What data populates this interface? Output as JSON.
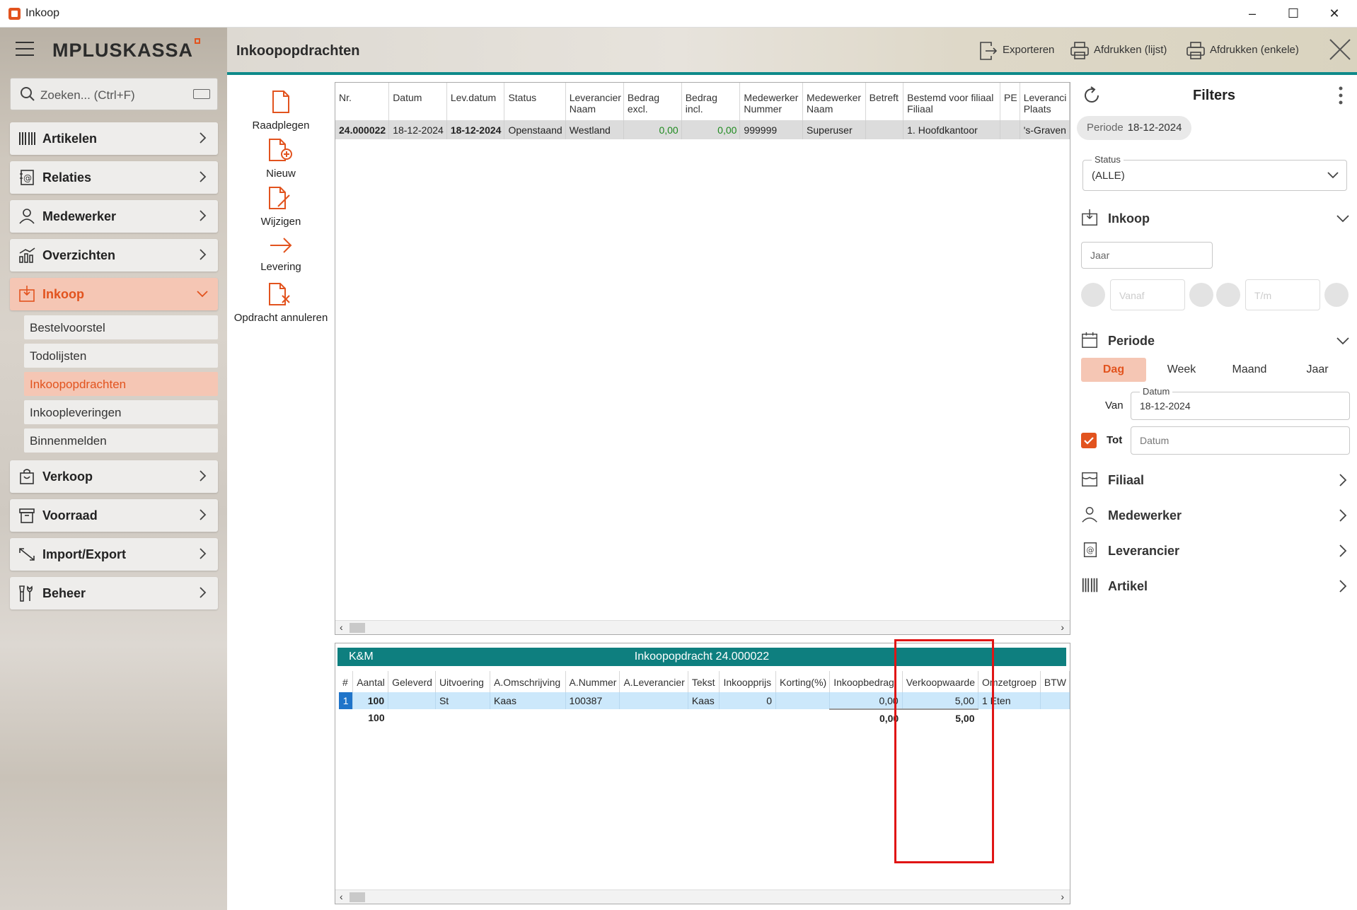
{
  "window": {
    "title": "Inkoop",
    "minimize": "–",
    "maximize": "☐",
    "close": "✕"
  },
  "sidebar": {
    "logo": "MPLUSKASSA",
    "search_placeholder": "Zoeken... (Ctrl+F)",
    "items": [
      {
        "label": "Artikelen",
        "icon": "barcode-icon"
      },
      {
        "label": "Relaties",
        "icon": "contacts-icon"
      },
      {
        "label": "Medewerker",
        "icon": "person-icon"
      },
      {
        "label": "Overzichten",
        "icon": "chart-icon"
      },
      {
        "label": "Inkoop",
        "icon": "inbox-icon"
      },
      {
        "label": "Verkoop",
        "icon": "bag-icon"
      },
      {
        "label": "Voorraad",
        "icon": "archive-icon"
      },
      {
        "label": "Import/Export",
        "icon": "import-export-icon"
      },
      {
        "label": "Beheer",
        "icon": "tools-icon"
      }
    ],
    "subitems": [
      "Bestelvoorstel",
      "Todolijsten",
      "Inkoopopdrachten",
      "Inkoopleveringen",
      "Binnenmelden"
    ],
    "active_item": "Inkoop",
    "active_subitem": "Inkoopopdrachten"
  },
  "header": {
    "title": "Inkoopopdrachten",
    "export": "Exporteren",
    "print_list": "Afdrukken (lijst)",
    "print_single": "Afdrukken (enkele)"
  },
  "actions": [
    "Raadplegen",
    "Nieuw",
    "Wijzigen",
    "Levering",
    "Opdracht annuleren"
  ],
  "top_grid": {
    "columns": [
      [
        "Nr.",
        ""
      ],
      [
        "Datum",
        ""
      ],
      [
        "Lev.datum",
        ""
      ],
      [
        "Status",
        ""
      ],
      [
        "Leverancier",
        "Naam"
      ],
      [
        "Bedrag excl.",
        ""
      ],
      [
        "Bedrag incl.",
        ""
      ],
      [
        "Medewerker",
        "Nummer"
      ],
      [
        "Medewerker",
        "Naam"
      ],
      [
        "Betreft",
        ""
      ],
      [
        "Bestemd voor filiaal",
        "Filiaal"
      ],
      [
        "PE",
        ""
      ],
      [
        "Leveranci",
        "Plaats"
      ]
    ],
    "row": [
      "24.000022",
      "18-12-2024",
      "18-12-2024",
      "Openstaand",
      "Westland",
      "0,00",
      "0,00",
      "999999",
      "Superuser",
      "",
      "1. Hoofdkantoor",
      "",
      "'s-Graven"
    ]
  },
  "bottom_grid": {
    "supplier": "K&M",
    "title": "Inkoopopdracht 24.000022",
    "columns": [
      "#",
      "Aantal",
      "Geleverd",
      "Uitvoering",
      "A.Omschrijving",
      "A.Nummer",
      "A.Leverancier",
      "Tekst",
      "Inkoopprijs",
      "Korting(%)",
      "Inkoopbedrag",
      "Verkoopwaarde",
      "Omzetgroep",
      "BTW"
    ],
    "row": [
      "1",
      "100",
      "",
      "St",
      "Kaas",
      "100387",
      "",
      "Kaas",
      "0",
      "",
      "0,00",
      "5,00",
      "1 Eten",
      ""
    ],
    "totals": {
      "aantal": "100",
      "inkoopbedrag": "0,00",
      "verkoopwaarde": "5,00"
    }
  },
  "filters": {
    "title": "Filters",
    "chip_key": "Periode",
    "chip_value": "18-12-2024",
    "status_label": "Status",
    "status_value": "(ALLE)",
    "inkoop": "Inkoop",
    "jaar_placeholder": "Jaar",
    "vanaf_placeholder": "Vanaf",
    "tm_placeholder": "T/m",
    "periode": "Periode",
    "segments": [
      "Dag",
      "Week",
      "Maand",
      "Jaar"
    ],
    "active_segment": "Dag",
    "van_label": "Van",
    "datum_label": "Datum",
    "datum_value": "18-12-2024",
    "tot_label": "Tot",
    "tot_placeholder": "Datum",
    "sections": [
      "Filiaal",
      "Medewerker",
      "Leverancier",
      "Artikel"
    ]
  },
  "colors": {
    "accent": "#e2531e",
    "teal": "#0e7f7f",
    "highlight": "#e01515"
  }
}
